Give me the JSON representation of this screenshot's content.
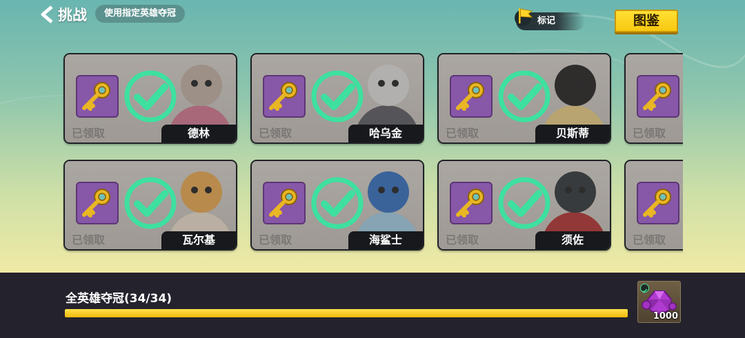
{
  "header": {
    "back_label": "挑战",
    "subtitle": "使用指定英雄夺冠",
    "mark_label": "标记",
    "codex_label": "图鉴"
  },
  "cards": [
    {
      "hero": "德林",
      "status": "已领取"
    },
    {
      "hero": "哈乌金",
      "status": "已领取"
    },
    {
      "hero": "贝斯蒂",
      "status": "已领取"
    },
    {
      "hero": "",
      "status": "已领取"
    },
    {
      "hero": "瓦尔基",
      "status": "已领取"
    },
    {
      "hero": "海鲨士",
      "status": "已领取"
    },
    {
      "hero": "须佐",
      "status": "已领取"
    },
    {
      "hero": "",
      "status": "已领取"
    }
  ],
  "goal": {
    "label": "全英雄夺冠(34/34)",
    "progress": 1.0,
    "reward_qty": "1000"
  },
  "colors": {
    "check": "#3ee0a0",
    "key_box": "#8757a8",
    "codex_button": "#ffd41f",
    "progress_fill": "#f8c811"
  }
}
